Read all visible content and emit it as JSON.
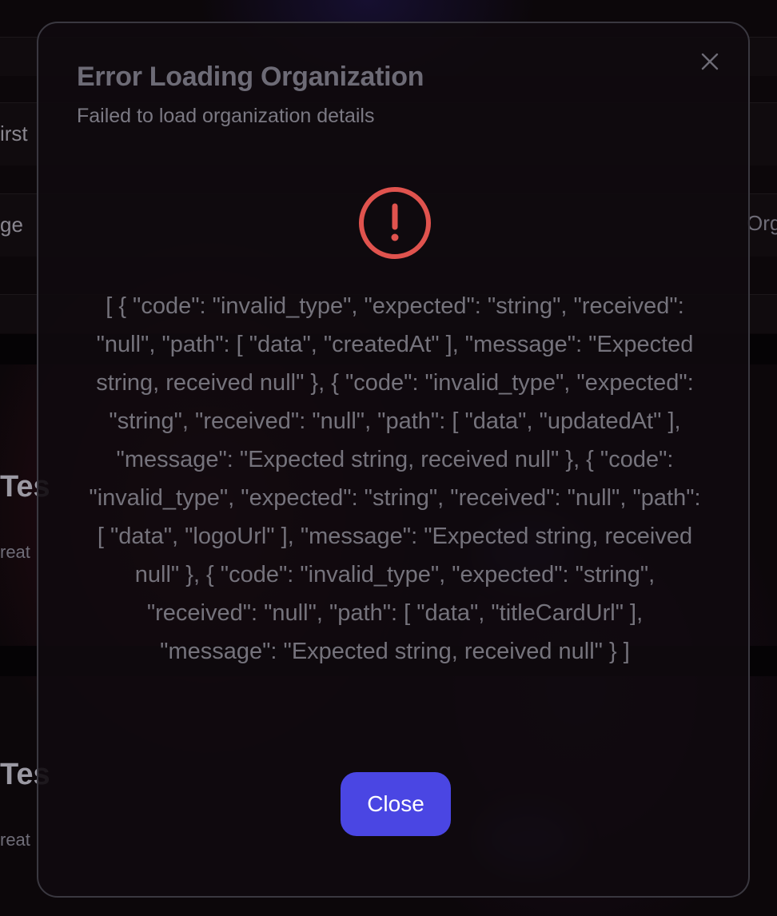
{
  "background": {
    "fragments": [
      "irst",
      "ge",
      "Org",
      "Tes",
      "reat",
      "Tes",
      "reat"
    ]
  },
  "modal": {
    "title": "Error Loading Organization",
    "subtitle": "Failed to load organization details",
    "error_message": "[ { \"code\": \"invalid_type\", \"expected\": \"string\", \"received\": \"null\", \"path\": [ \"data\", \"createdAt\" ], \"message\": \"Expected string, received null\" }, { \"code\": \"invalid_type\", \"expected\": \"string\", \"received\": \"null\", \"path\": [ \"data\", \"updatedAt\" ], \"message\": \"Expected string, received null\" }, { \"code\": \"invalid_type\", \"expected\": \"string\", \"received\": \"null\", \"path\": [ \"data\", \"logoUrl\" ], \"message\": \"Expected string, received null\" }, { \"code\": \"invalid_type\", \"expected\": \"string\", \"received\": \"null\", \"path\": [ \"data\", \"titleCardUrl\" ], \"message\": \"Expected string, received null\" } ]",
    "close_button_label": "Close",
    "close_icon": "close-icon",
    "alert_icon": "alert-circle-icon"
  },
  "colors": {
    "accent": "#4a46e3",
    "error": "#e0534e",
    "modal_border": "#3a3840"
  }
}
